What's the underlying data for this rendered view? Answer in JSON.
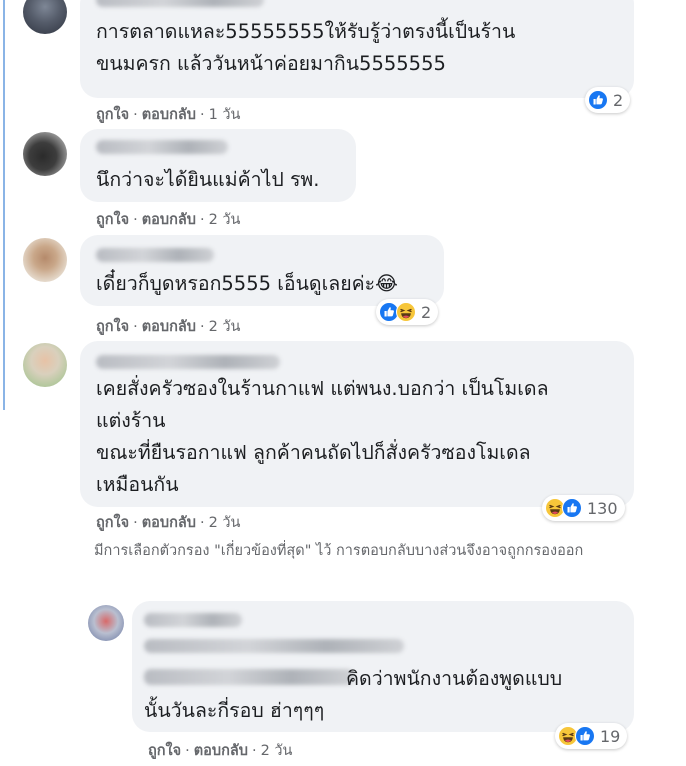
{
  "comments": [
    {
      "lines": [
        "การตลาดแหละ55555555ให้รับรู้ว่าตรงนี้เป็นร้าน",
        "ขนมครก แล้ววันหน้าค่อยมากิน5555555"
      ],
      "actions": {
        "like": "ถูกใจ",
        "reply": "ตอบกลับ",
        "time": "1 วัน"
      },
      "reactions": {
        "types": [
          "like-icon"
        ],
        "count": "2"
      }
    },
    {
      "lines": [
        "นึกว่าจะได้ยินแม่ค้าไป รพ."
      ],
      "actions": {
        "like": "ถูกใจ",
        "reply": "ตอบกลับ",
        "time": "2 วัน"
      }
    },
    {
      "lines": [
        "เดี๋ยวก็บูดหรอก5555 เอ็นดูเลยค่ะ😂"
      ],
      "actions": {
        "like": "ถูกใจ",
        "reply": "ตอบกลับ",
        "time": "2 วัน"
      },
      "reactions": {
        "types": [
          "like-icon",
          "haha-icon"
        ],
        "count": "2"
      }
    },
    {
      "lines": [
        "เคยสั่งครัวซองในร้านกาแฟ แต่พนง.บอกว่า เป็นโมเดล",
        "แต่งร้าน",
        "ขณะที่ยืนรอกาแฟ ลูกค้าคนถัดไปก็สั่งครัวซองโมเดล",
        "เหมือนกัน"
      ],
      "actions": {
        "like": "ถูกใจ",
        "reply": "ตอบกลับ",
        "time": "2 วัน"
      },
      "reactions": {
        "types": [
          "haha-icon",
          "like-icon"
        ],
        "count": "130"
      }
    }
  ],
  "filter_note": "มีการเลือกตัวกรอง \"เกี่ยวข้องที่สุด\" ไว้ การตอบกลับบางส่วนจึงอาจถูกกรองออก",
  "reply": {
    "lines": [
      "คิดว่าพนักงานต้องพูดแบบ",
      "นั้นวันละกี่รอบ ฮ่าๆๆๆ"
    ],
    "actions": {
      "like": "ถูกใจ",
      "reply": "ตอบกลับ",
      "time": "2 วัน"
    },
    "reactions": {
      "types": [
        "haha-icon",
        "like-icon"
      ],
      "count": "19"
    }
  },
  "colors": {
    "like": "#1877f2",
    "haha": "#f7b125",
    "bubble": "#f0f2f5",
    "meta": "#65676b"
  }
}
